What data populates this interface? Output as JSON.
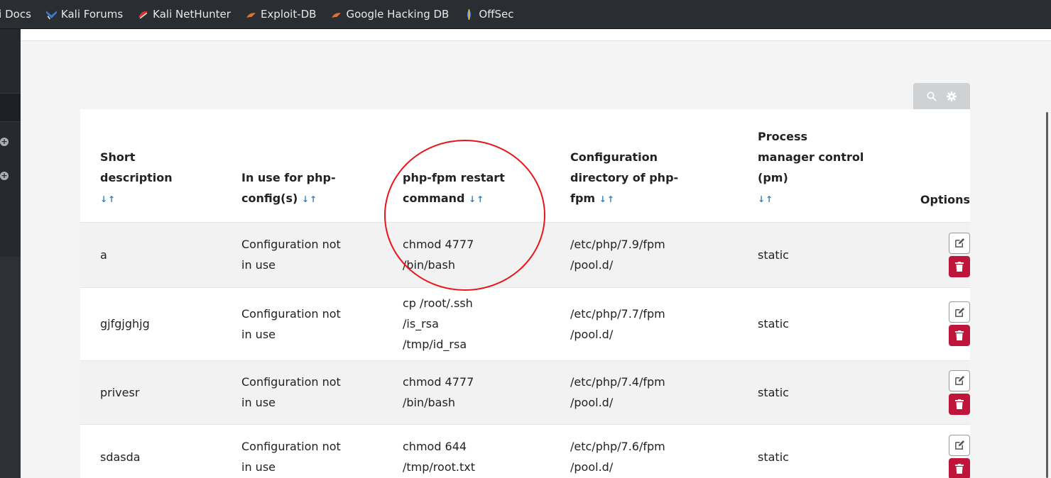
{
  "bookmarks": [
    {
      "label": "li Docs",
      "icon": "kali-docs-icon",
      "color": "#3b7ad8"
    },
    {
      "label": "Kali Forums",
      "icon": "kali-forums-icon",
      "color": "#3b7ad8"
    },
    {
      "label": "Kali NetHunter",
      "icon": "kali-nethunter-icon",
      "color": "#d9342b"
    },
    {
      "label": "Exploit-DB",
      "icon": "exploit-db-icon",
      "color": "#e8702a"
    },
    {
      "label": "Google Hacking DB",
      "icon": "google-hacking-db-icon",
      "color": "#e8702a"
    },
    {
      "label": "OffSec",
      "icon": "offsec-icon",
      "color": "#4a7de0"
    }
  ],
  "table": {
    "headers": {
      "short_description": "Short description",
      "in_use": "In use for php-config(s)",
      "restart_command": "php-fpm restart command",
      "config_dir": "Configuration directory of php-fpm",
      "pm": "Process manager control (pm)",
      "options": "Options"
    },
    "sort_arrows": "↓↑",
    "rows": [
      {
        "desc": "a",
        "in_use": "Configuration not in use",
        "command": "chmod 4777 /bin/bash",
        "dir": "/etc/php/7.9/fpm /pool.d/",
        "pm": "static"
      },
      {
        "desc": "gjfgjghjg",
        "in_use": "Configuration not in use",
        "command": "cp /root/.ssh /is_rsa /tmp/id_rsa",
        "dir": "/etc/php/7.7/fpm /pool.d/",
        "pm": "static"
      },
      {
        "desc": "privesr",
        "in_use": "Configuration not in use",
        "command": "chmod 4777 /bin/bash",
        "dir": "/etc/php/7.4/fpm /pool.d/",
        "pm": "static"
      },
      {
        "desc": "sdasda",
        "in_use": "Configuration not in use",
        "command": "chmod 644 /tmp/root.txt",
        "dir": "/etc/php/7.6/fpm /pool.d/",
        "pm": "static"
      }
    ]
  },
  "toolbar": {
    "search_icon": "search-icon",
    "settings_icon": "gear-icon"
  },
  "colors": {
    "delete": "#c0153b",
    "sort_arrows": "#3c7fb8",
    "annotation": "#e8151c"
  }
}
